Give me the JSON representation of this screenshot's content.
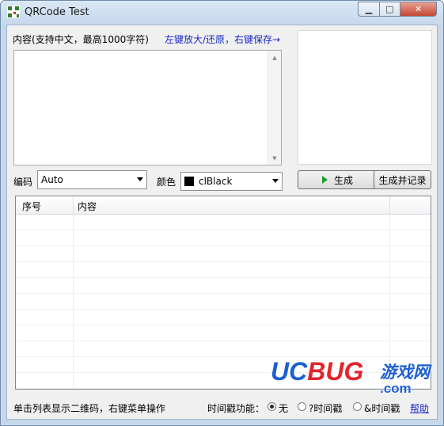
{
  "window": {
    "title": "QRCode Test"
  },
  "titlebar_buttons": {
    "minimize": "▁",
    "maximize": "□",
    "close": "✕"
  },
  "content": {
    "label": "内容(支持中文，最高1000字符)",
    "hint": "左键放大/还原，右键保存→",
    "text_value": ""
  },
  "encoding": {
    "label": "编码",
    "value": "Auto"
  },
  "color": {
    "label": "颜色",
    "value": "clBlack",
    "swatch": "#000000"
  },
  "buttons": {
    "generate": "生成",
    "generate_record": "生成并记录"
  },
  "table": {
    "columns": [
      "序号",
      "内容"
    ],
    "rows": []
  },
  "status": {
    "hint": "单击列表显示二维码，右键菜单操作",
    "timestamp_label": "时间戳功能：",
    "options": [
      "无",
      "?时间戳",
      "&时间戳"
    ],
    "selected": "无",
    "help": "帮助"
  },
  "watermark": {
    "brand": "UCBUG",
    "cn": "游戏网",
    "domain": ".com"
  },
  "colors": {
    "titlebar": "#c7d8ea",
    "client": "#f0f0f0",
    "link": "#1a28c8",
    "watermark_blue": "#1d5fd1",
    "watermark_red": "#e0262c"
  }
}
